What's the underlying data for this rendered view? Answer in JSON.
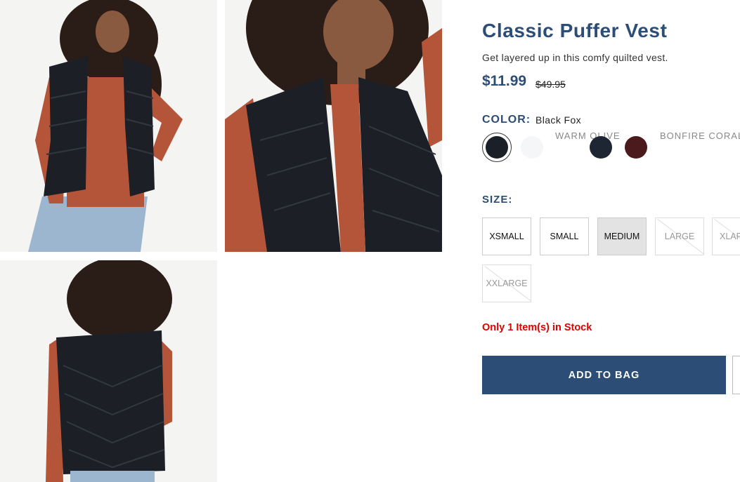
{
  "product": {
    "title": "Classic Puffer Vest",
    "subtitle": "Get layered up in this comfy quilted vest.",
    "price": "$11.99",
    "original_price": "$49.95"
  },
  "color": {
    "label": "COLOR:",
    "selected": "Black Fox",
    "swatches": [
      {
        "name": "Black Fox",
        "hex": "#1b1f27"
      },
      {
        "name": "White",
        "hex": "#f5f6f8"
      },
      {
        "name": "Navy",
        "hex": "#1e2634"
      },
      {
        "name": "Burgundy",
        "hex": "#4a1a1c"
      }
    ],
    "text_swatches": [
      "WARM OLIVE",
      "BONFIRE CORAL"
    ]
  },
  "size": {
    "label": "SIZE:",
    "options": [
      {
        "label": "XSMALL",
        "available": true
      },
      {
        "label": "SMALL",
        "available": true
      },
      {
        "label": "MEDIUM",
        "available": true,
        "selected": true
      },
      {
        "label": "LARGE",
        "available": false
      },
      {
        "label": "XLARGE",
        "available": false
      },
      {
        "label": "XXLARGE",
        "available": false
      }
    ]
  },
  "stock_message": "Only 1 Item(s) in Stock",
  "add_to_bag_label": "ADD TO BAG",
  "colors": {
    "brand": "#2c4d75",
    "alert": "#e00000",
    "vest": "#1c1f26",
    "top": "#b4553a"
  }
}
